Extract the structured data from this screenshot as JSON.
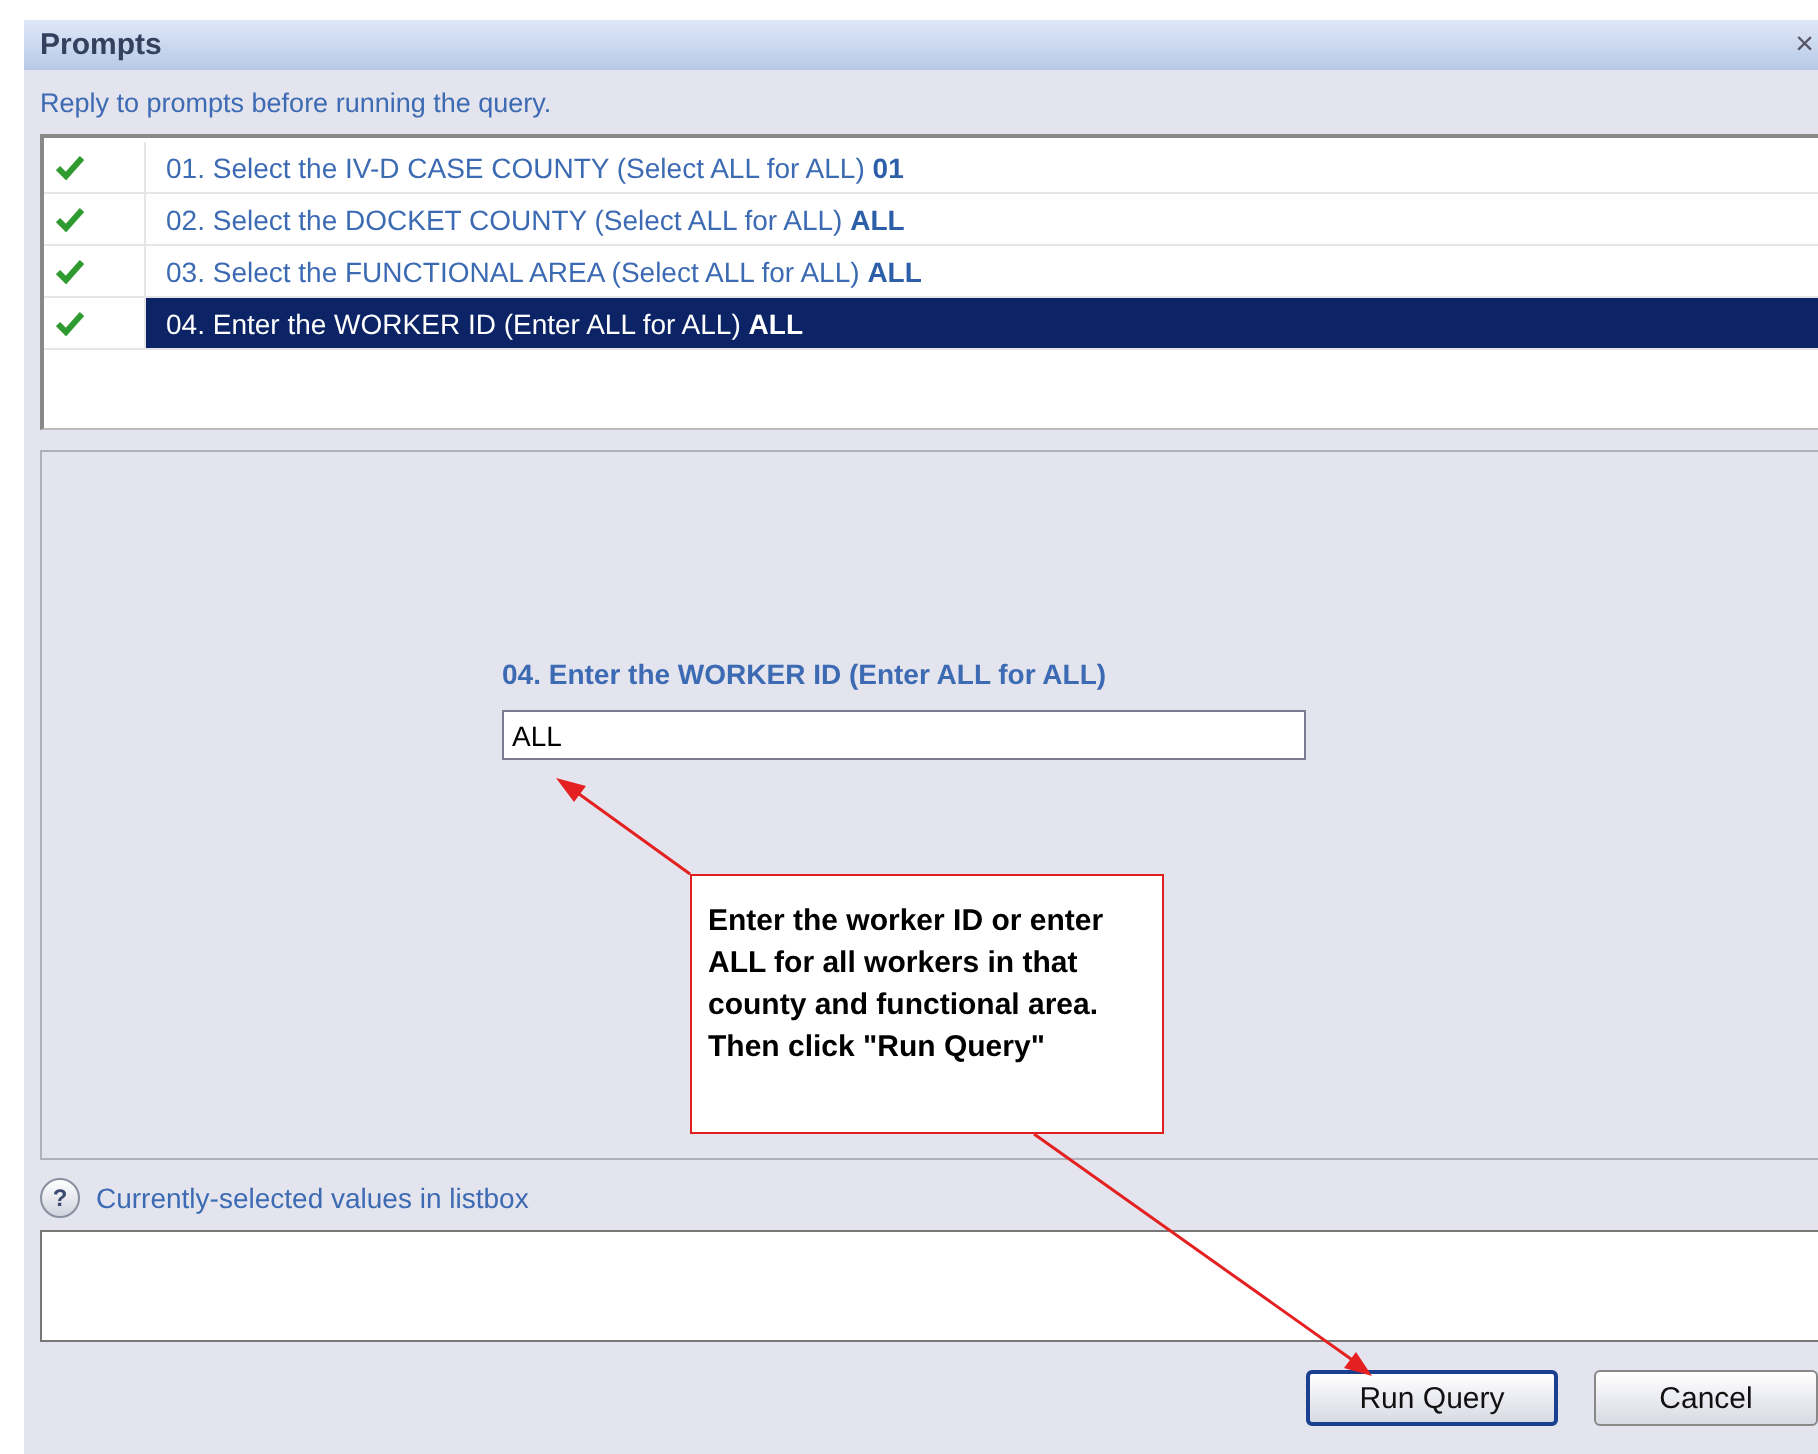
{
  "window": {
    "title": "Prompts",
    "close": "×"
  },
  "instruction": "Reply to prompts before running the query.",
  "prompts": [
    {
      "label": "01. Select the IV-D CASE COUNTY (Select ALL for ALL)",
      "value": "01",
      "checked": true,
      "selected": false
    },
    {
      "label": "02. Select the DOCKET COUNTY (Select ALL for ALL)",
      "value": "ALL",
      "checked": true,
      "selected": false
    },
    {
      "label": "03. Select the FUNCTIONAL AREA (Select ALL for ALL)",
      "value": "ALL",
      "checked": true,
      "selected": false
    },
    {
      "label": "04. Enter the WORKER ID (Enter ALL for ALL)",
      "value": "ALL",
      "checked": true,
      "selected": true
    }
  ],
  "detail": {
    "label": "04. Enter the WORKER ID (Enter ALL for ALL)",
    "value": "ALL"
  },
  "callout": "Enter the worker ID or enter ALL for all workers in that county and functional area. Then click \"Run Query\"",
  "help": {
    "icon": "?",
    "label": "Currently-selected values in listbox"
  },
  "buttons": [
    {
      "label": "Run Query",
      "selected": true
    },
    {
      "label": "Cancel",
      "selected": false
    }
  ]
}
